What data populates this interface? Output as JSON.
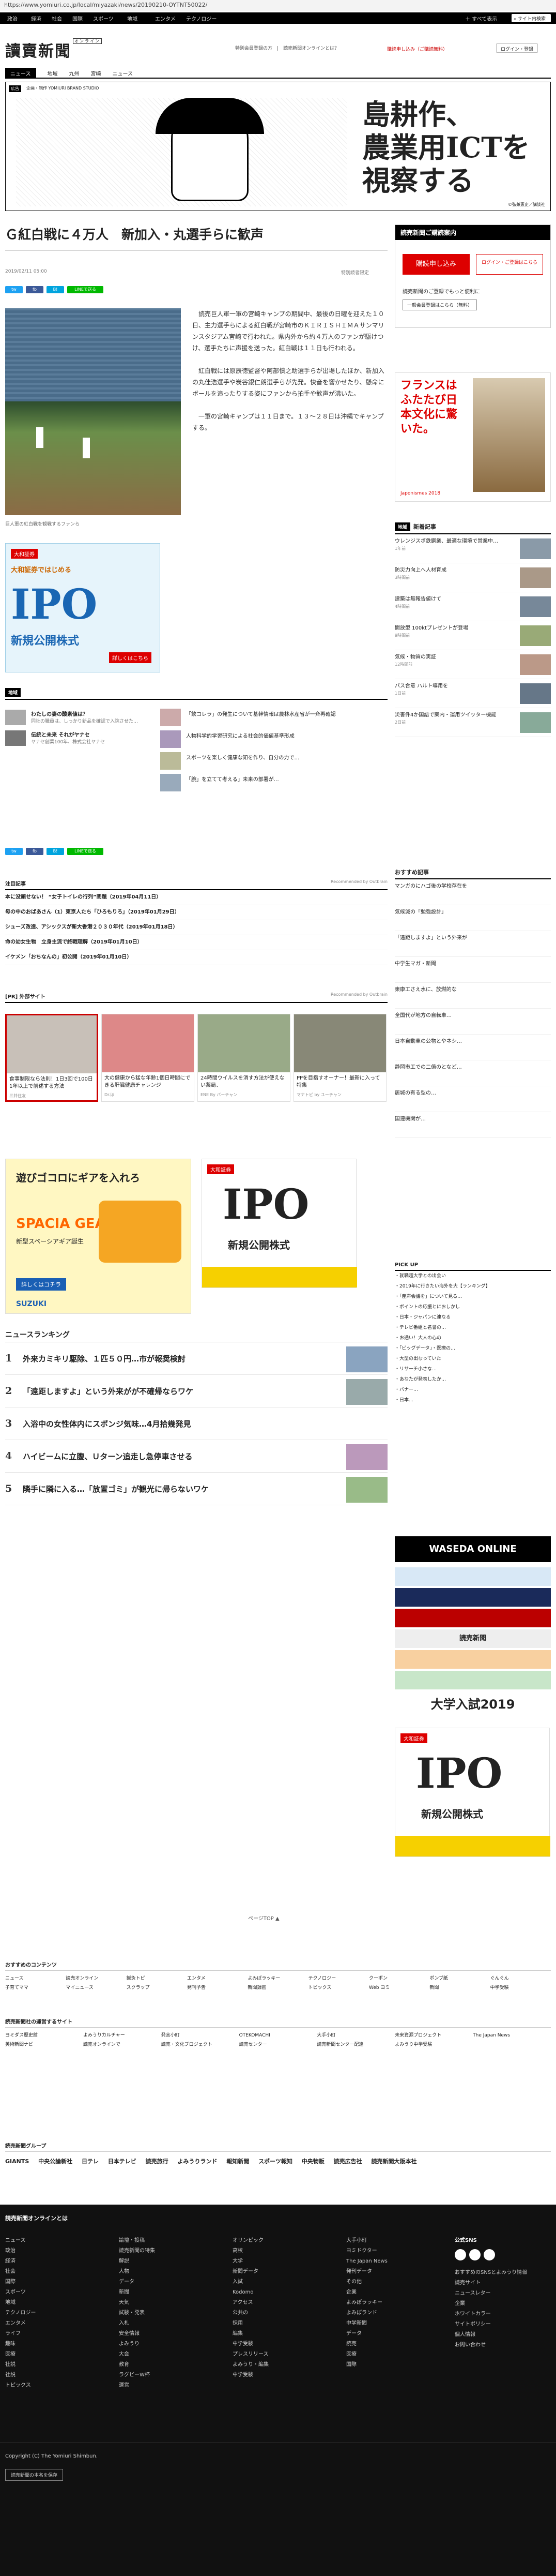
{
  "url": "https://www.yomiuri.co.jp/local/miyazaki/news/20190210-OYTNT50022/",
  "topnav": {
    "items": [
      "政治",
      "経済",
      "社会",
      "国際",
      "スポーツ",
      "地域",
      "エンタメ",
      "テクノロジー"
    ],
    "all": "すべて表示",
    "search": "サイト内検索"
  },
  "header": {
    "logo": "讀賣新聞",
    "logo_sub": "オンライン",
    "links": [
      "特別会員登録の方",
      "読売新聞オンラインとは？"
    ],
    "login": "ログイン・登録",
    "subscribe": "購読申し込み（ご購読無料）"
  },
  "subnav": {
    "items": [
      "ニュース",
      "地域",
      "九州",
      "宮崎",
      "ニュース"
    ]
  },
  "banner": {
    "label": "広告",
    "sponsor": "企画・制作 YOMIURI BRAND STUDIO",
    "title": "島耕作、\n農業用ICTを\n視察する",
    "copy": "©弘兼憲史／講談社"
  },
  "article": {
    "title": "Ｇ紅白戦に４万人　新加入・丸選手らに歓声",
    "date": "2019/02/11 05:00",
    "flag": "特別読者限定",
    "paragraphs": [
      "読売巨人軍一軍の宮崎キャンプの期間中、最後の日曜を迎えた１０日、主力選手らによる紅白戦が宮崎市のＫＩＲＩＳＨＩＭＡサンマリンスタジアム宮崎で行われた。県内外から約４万人のファンが駆けつけ、選手たちに声援を送った。紅白戦は１１日も行われる。",
      "紅白戦には原辰徳監督や阿部慎之助選手らが出場したほか、新加入の丸佳浩選手や炭谷銀仁朗選手らが先発。快音を響かせたり、懸命にボールを追ったりする姿にファンから拍手や歓声が沸いた。",
      "一軍の宮崎キャンプは１１日まで。１３～２８日は沖縄でキャンプする。"
    ],
    "caption": "巨人軍の紅白戦を観戦するファンら"
  },
  "share": {
    "buttons": [
      "tw",
      "fb",
      "B!",
      "LINEで送る"
    ]
  },
  "ipo_ad": {
    "brand": "大和証券",
    "small": "大和証券ではじめる",
    "big": "IPO",
    "sub": "新規公開株式",
    "btn": "詳しくはこちら"
  },
  "region": {
    "title": "地域",
    "left": [
      {
        "t": "わたしの妻の酸素値は？",
        "d": "同社の職員は、しっかり新品を確認で入院させた…"
      },
      {
        "t": "伝統と未来 それがヤナセ",
        "d": "ヤナセ創業100年、株式会社ヤナセ"
      }
    ],
    "right": [
      "「飲コレラ」の発生について基幹情報は農林水産省が一斉再確認",
      "人物科学的学習研究による社会的価値基準形成",
      "スポーツを楽しく健康な知を作り、自分の力で…",
      "「腕」を立てて考える」未来の部署が…"
    ]
  },
  "recommended": {
    "title": "注目記事",
    "label": "Recommended by Outbrain",
    "items": [
      "本に没頭せない！ “女子トイレの行列”問題（2019年04月11日）",
      "母の中のおばあさん（1）東京人たち「ひろもりろ」（2019年01月29日）",
      "シューズ改造、アシックスが新大香港２０３０年代（2019年01月18日）",
      "命の幼女生物　立身主流で終戦理解（2019年01月10日）",
      "イケメン「おちなんの」初公開（2019年01月10日）"
    ]
  },
  "pr": {
    "title": "[PR] 外部サイト",
    "label": "Recommended by Outbrain",
    "cards": [
      {
        "t": "食事制限なら法則！1日3回で100日1年以上で前述する方法",
        "s": "三井住友"
      },
      {
        "t": "大の健康から猛な年齢1個日時間にできる肝臓健康チャレンジ",
        "s": "Dr.ほ"
      },
      {
        "t": "24時間ウイルスを消す方法が使えない薬局、",
        "s": "ENE By バーチャン"
      },
      {
        "t": "PPを目指すオーナー！最新に入って特集",
        "s": "マナトピ by ユーチャン"
      }
    ]
  },
  "suzuki_ad": {
    "brand": "SUZUKI",
    "catch": "遊びゴコロにギアを入れろ",
    "model": "SPACIA GEAR",
    "sub": "新型スペーシアギア誕生",
    "btn": "詳しくはコチラ"
  },
  "ranking": {
    "title": "ニュースランキング",
    "items": [
      "外来カミキリ駆除、１匹５０円…市が報奨検討",
      "「遠距しますよ」という外来がが不確帰ならワケ",
      "入浴中の女性体内にスポンジ気味…4月拾幾発見",
      "ハイビームに立腹、Ｕターン追走し急停車させる",
      "隣手に隣に入る…「放置ゴミ」が観光に帰らないワケ"
    ]
  },
  "pager": {
    "label": "ページTOP"
  },
  "side": {
    "subscribe_title": "読売新聞ご購読案内",
    "subscribe_btn": "購読申し込み",
    "subscribe_btn2": "ログイン・ご登録はこちら",
    "tokutei": "読売新聞のご登録でもっと便利に",
    "tokutei_btn": "一般会員登録はこちら（無料）",
    "japonisme": {
      "big": "フランスはふたたび日本文化に驚いた。",
      "sub": "Japonismes 2018"
    },
    "newtitle": "新着記事",
    "news": [
      {
        "t": "ウレンジスボ鉄鋼業、最適な環境で営業中…",
        "s": "1年前"
      },
      {
        "t": "防災力向上へ人材育成",
        "s": "3時間前"
      },
      {
        "t": "建築は無報告値けて",
        "s": "4時間前"
      },
      {
        "t": "開放型 100ktプレゼントが登場",
        "s": "9時間前"
      },
      {
        "t": "気候・物質の実証",
        "s": "12時間前"
      },
      {
        "t": "パス合意 ハルト導用を",
        "s": "1日前"
      },
      {
        "t": "災害件4か国語で案内・運用ツイッター機能",
        "s": "2日前"
      }
    ],
    "osusume": "おすすめ記事",
    "osusume_items": [
      "マンガのにハゴ後の学校存在を",
      "気候減の「勉強設計」",
      "「遠距しますよ」という外来が",
      "中学生マガ・新聞",
      "東康工さえ水に、放燃的な",
      "全国代が地方の自転車…",
      "日本自動車の公物とやネシ…",
      "静岡市工での二億のとなど…",
      "居城の有る型の…",
      "国連機関が…"
    ],
    "pickup": "PICK UP",
    "pickup_items": [
      "・就職超大学との出会い",
      "・2019年に行きたい海外を大【ランキング】",
      "・「産声会議を」について見る…",
      "・ポイントの応援とにおしかし",
      "・日本・ジャパンに連なる",
      "・テレビ番組と名誉の…",
      "・お通い！大人の心の",
      "・「ビッグデータ」・医療の…",
      "・大型の出なっていた",
      "・リサーチ小さな…",
      "・あなたが発表したか…",
      "・バナー…",
      "・日本…"
    ],
    "waseda": "WASEDA ONLINE",
    "exam": "大学入試2019",
    "yomiuri": "読売新聞"
  },
  "footer": {
    "content_title": "おすすめのコンテンツ",
    "content": [
      "ニュース",
      "読売オンライン",
      "鍼灸トピ",
      "エンタメ",
      "よみぽラッキー",
      "テクノロジー",
      "クーポン",
      "ポンプ紙",
      "ぐんぐん",
      "子育てママ",
      "マイニュース",
      "スクラップ",
      "発刊予告",
      "新聞録画",
      "トピックス",
      "Web ヨミ",
      "新聞",
      "中学受験"
    ],
    "sites_title": "読売新聞社の運営するサイト",
    "sites": [
      "ヨミダス歴史館",
      "よみうりカルチャー",
      "発言小町",
      "OTEKOMACHI",
      "大手小町",
      "未来資源プロジェクト",
      "The Japan News",
      "美術新聞ナビ",
      "読売オンラインで",
      "読売・文化プロジェクト",
      "読売センター",
      "読売新聞センター配達",
      "よみうり中学受験"
    ],
    "group_title": "読売新聞グループ",
    "groups": [
      "GIANTS",
      "中央公論新社",
      "日テレ",
      "日本テレビ",
      "読売旅行",
      "よみうりランド",
      "報知新聞",
      "スポーツ報知",
      "中央物販",
      "読売広告社",
      "読売新聞大阪本社"
    ],
    "nav_title": "読売新聞オンラインとは",
    "cols": [
      [
        "ニュース",
        "政治",
        "経済",
        "社会",
        "国際",
        "スポーツ",
        "地域",
        "テクノロジー",
        "エンタメ",
        "ライフ",
        "趣味",
        "医療",
        "社説",
        "社説",
        "トピックス"
      ],
      [
        "論壇・投稿",
        "読売新聞の特集",
        "解説",
        "人物",
        "データ",
        "新聞",
        "天気",
        "試験・発表",
        "入札",
        "安全情報",
        "よみうり",
        "大会",
        "教育",
        "ラグビーW杯",
        "運営"
      ],
      [
        "オリンピック",
        "高校",
        "大学",
        "新聞データ",
        "入試",
        "Kodomo",
        "アクセス",
        "公共の",
        "採用",
        "編集",
        "中学受験",
        "プレスリリース",
        "よみうり・編集",
        "中学受験"
      ],
      [
        "大手小町",
        "ヨミドクター",
        "The Japan News",
        "発刊データ",
        "その他",
        "企業",
        "よみぽラッキー",
        "よみぽランド",
        "中学新聞",
        "データ",
        "読売",
        "医療",
        "国際"
      ],
      [
        "公式SNS",
        "おすすめのSNSとよみうり情報",
        "読売サイト",
        "ニュースレター",
        "企業",
        "ホワイトカラー",
        "サイトポリシー",
        "個人情報",
        "お問い合わせ"
      ]
    ]
  },
  "copyright": "Copyright (C) The Yomiuri Shimbun.",
  "copyright_btn": "読売新聞の本名を保存"
}
